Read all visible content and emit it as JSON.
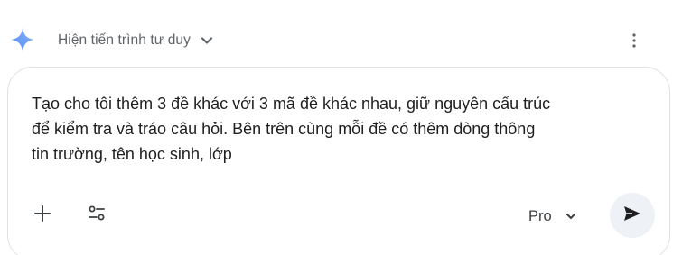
{
  "thinking": {
    "label": "Hiện tiến trình tư duy",
    "icon": "spark-icon",
    "toggle_icon": "chevron-down-icon",
    "menu_icon": "more-vertical-icon"
  },
  "composer": {
    "text": "Tạo cho tôi thêm 3 đề khác với 3 mã đề khác nhau, giữ nguyên cấu trúc\nđể kiểm tra và tráo câu hỏi. Bên trên cùng mỗi đề có thêm dòng thông\ntin trường, tên học sinh, lớp",
    "add_icon": "plus-icon",
    "tools_icon": "tools-icon",
    "model": {
      "label": "Pro",
      "icon": "chevron-down-icon"
    },
    "send_icon": "send-icon"
  },
  "colors": {
    "accent_blue": "#4c8df6",
    "text_primary": "#1f1f1f",
    "text_secondary": "#5f6368",
    "send_button_bg": "#eef1f6",
    "border": "#dfe1e5"
  }
}
